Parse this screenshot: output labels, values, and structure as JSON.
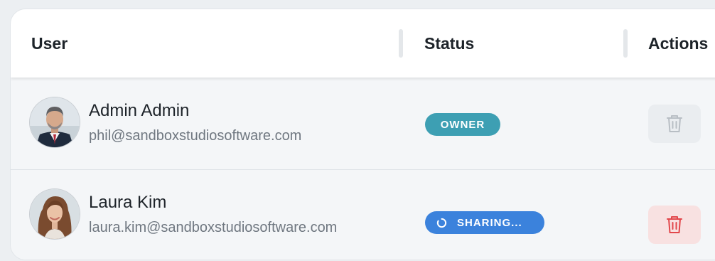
{
  "table": {
    "headers": {
      "user": "User",
      "status": "Status",
      "actions": "Actions"
    },
    "rows": [
      {
        "name": "Admin Admin",
        "email": "phil@sandboxstudiosoftware.com",
        "status": "OWNER",
        "status_color": "#3d9fb3",
        "action_icon": "trash-icon",
        "action_state": "disabled"
      },
      {
        "name": "Laura Kim",
        "email": "laura.kim@sandboxstudiosoftware.com",
        "status": "SHARING...",
        "status_color": "#3b82dc",
        "status_icon": "spinner-icon",
        "action_icon": "trash-icon",
        "action_state": "danger",
        "action_color": "#e2474b"
      }
    ]
  }
}
